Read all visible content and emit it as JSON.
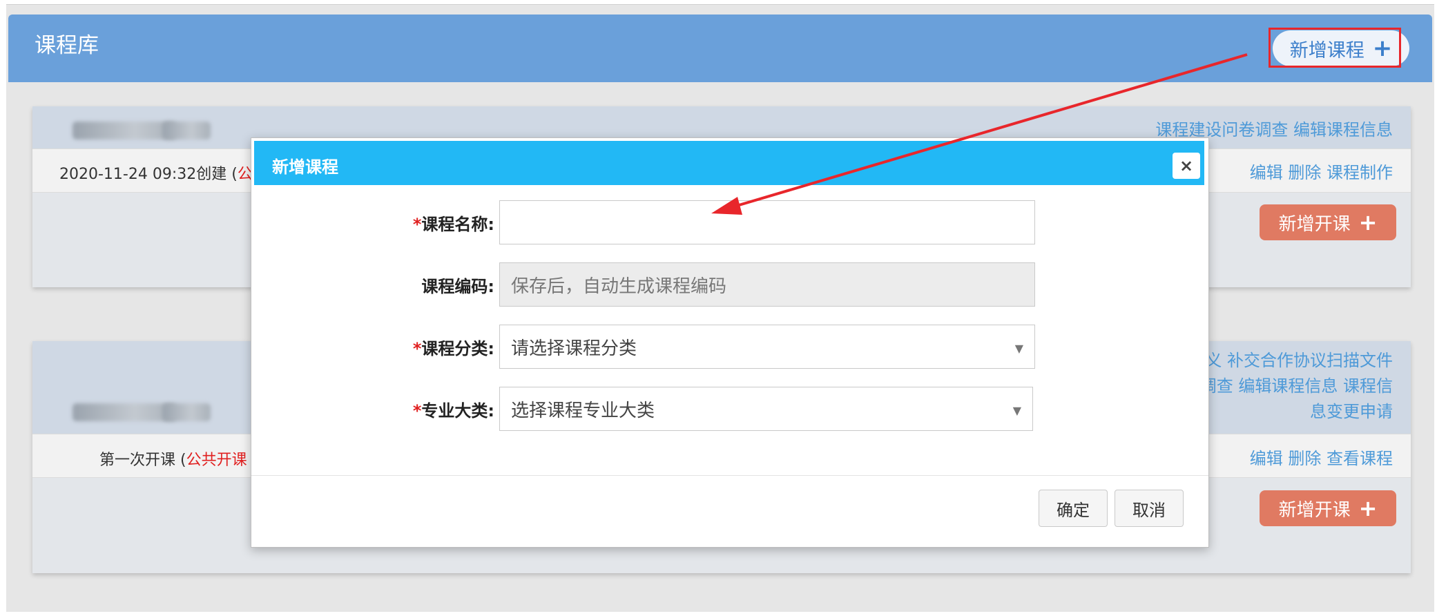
{
  "header": {
    "title": "课程库",
    "add_course_label": "新增课程"
  },
  "courses": [
    {
      "actions_top": "课程建设问卷调查 编辑课程信息",
      "meta_date": "2020-11-24 09:32创建 (",
      "meta_tag": "公",
      "actions_row": "编辑  删除  课程制作",
      "open_course_label": "新增开课"
    },
    {
      "actions_top_lines": [
        "义 补交合作协议扫描文件",
        "调查 编辑课程信息 课程信",
        "息变更申请"
      ],
      "meta_text": "第一次开课 (",
      "meta_tag": "公共开课",
      "actions_row": "编辑  删除  查看课程",
      "open_course_label": "新增开课"
    }
  ],
  "modal": {
    "title": "新增课程",
    "close_icon": "×",
    "fields": [
      {
        "label": "课程名称:",
        "required": "*",
        "value": "",
        "placeholder": ""
      },
      {
        "label": "课程编码:",
        "required": "",
        "placeholder": "保存后，自动生成课程编码"
      },
      {
        "label": "课程分类:",
        "required": "*",
        "selected": "请选择课程分类"
      },
      {
        "label": "专业大类:",
        "required": "*",
        "selected": "选择课程专业大类"
      }
    ],
    "confirm_label": "确定",
    "cancel_label": "取消"
  },
  "colors": {
    "header_bg": "#6aa0da",
    "modal_header_bg": "#22b8f5",
    "accent_orange": "#e07a62",
    "annotation_red": "#e8262b",
    "link_blue": "#4e9ad8"
  },
  "icons": {
    "plus": "+",
    "select_caret": "▼"
  }
}
